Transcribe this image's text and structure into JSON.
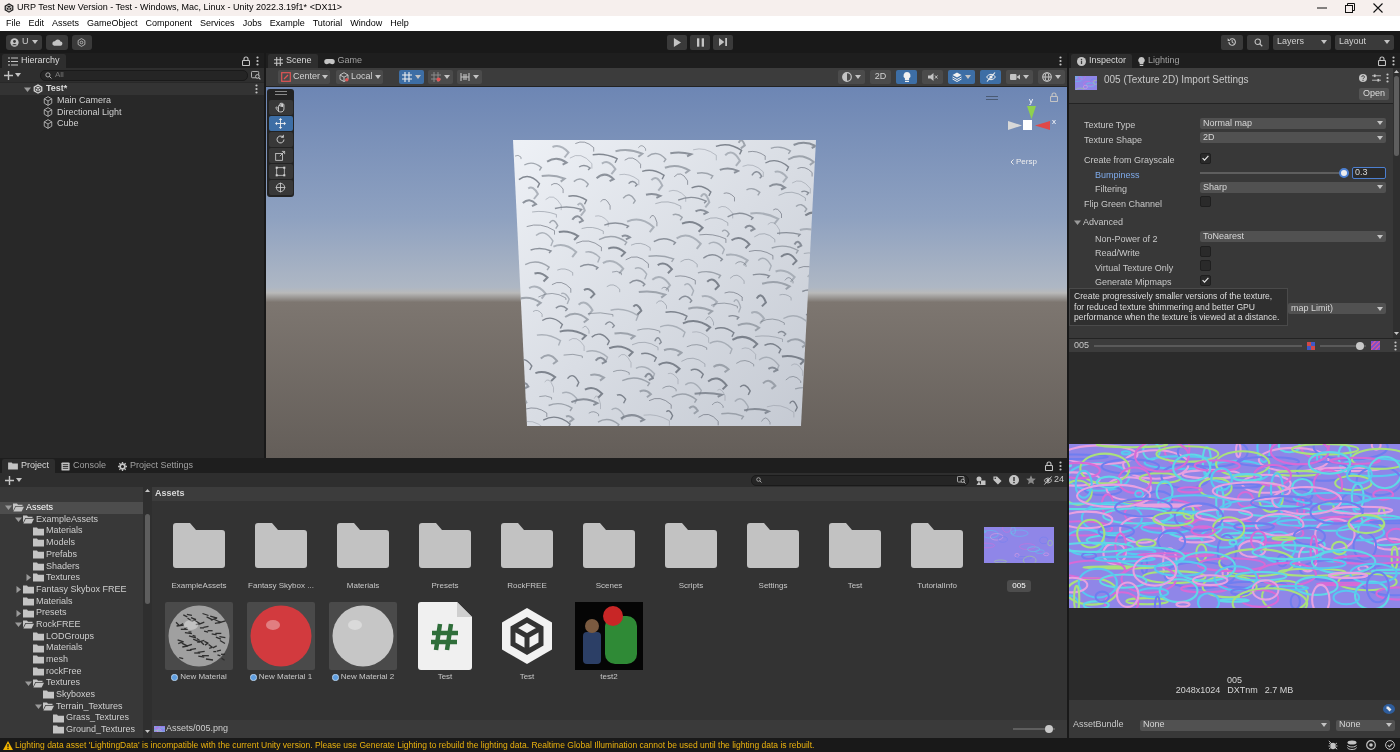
{
  "window": {
    "title": "URP Test New Version - Test - Windows, Mac, Linux - Unity 2022.3.19f1* <DX11>"
  },
  "menu": [
    "File",
    "Edit",
    "Assets",
    "GameObject",
    "Component",
    "Services",
    "Jobs",
    "Example",
    "Tutorial",
    "Window",
    "Help"
  ],
  "toolbar": {
    "account": "U",
    "layers": "Layers",
    "layout": "Layout"
  },
  "hierarchy": {
    "tabs": [
      {
        "label": "Hierarchy",
        "kind": "list",
        "selected": true
      }
    ],
    "search_placeholder": "All",
    "scene": {
      "name": "Test*",
      "expanded": true,
      "children": [
        {
          "name": "Main Camera"
        },
        {
          "name": "Directional Light"
        },
        {
          "name": "Cube"
        }
      ]
    }
  },
  "scene_view": {
    "tabs": [
      {
        "label": "Scene",
        "kind": "scene",
        "selected": true
      },
      {
        "label": "Game",
        "kind": "game",
        "selected": false
      }
    ],
    "pivot": "Center",
    "space": "Local",
    "snapping": [
      {
        "kind": "grid",
        "on": true
      },
      {
        "kind": "dots",
        "on": false
      },
      {
        "kind": "increment",
        "on": false
      }
    ],
    "toggles": [
      {
        "kind": "shading",
        "on": false
      },
      {
        "kind": "mode2d",
        "label": "2D",
        "on": false
      },
      {
        "kind": "lighting",
        "on": true
      },
      {
        "kind": "audio",
        "on": false
      },
      {
        "kind": "effects",
        "on": true
      },
      {
        "kind": "visibility",
        "on": true
      },
      {
        "kind": "camera",
        "on": false
      },
      {
        "kind": "gizmos",
        "on": false
      }
    ],
    "tools": [
      {
        "kind": "hand",
        "selected": false
      },
      {
        "kind": "move",
        "selected": true
      },
      {
        "kind": "rotate",
        "selected": false
      },
      {
        "kind": "scale",
        "selected": false
      },
      {
        "kind": "rect",
        "selected": false
      },
      {
        "kind": "transform",
        "selected": false
      }
    ],
    "gizmo": {
      "y_label": "y",
      "x_label": "x",
      "projection": "Persp"
    }
  },
  "inspector": {
    "tabs": [
      {
        "label": "Inspector",
        "kind": "info",
        "selected": true
      },
      {
        "label": "Lighting",
        "kind": "light",
        "selected": false
      }
    ],
    "title": "005 (Texture 2D) Import Settings",
    "open_button": "Open",
    "properties": [
      {
        "kind": "dropdown",
        "label": "Texture Type",
        "value": "Normal map"
      },
      {
        "kind": "dropdown",
        "label": "Texture Shape",
        "value": "2D"
      },
      {
        "kind": "checkbox",
        "label": "Create from Grayscale",
        "checked": true,
        "children": [
          {
            "kind": "slider",
            "label": "Bumpiness",
            "level": 1,
            "value": "0.3",
            "focused": true
          },
          {
            "kind": "dropdown",
            "label": "Filtering",
            "value": "Sharp"
          }
        ]
      },
      {
        "kind": "checkbox",
        "label": "Flip Green Channel",
        "checked": false
      },
      {
        "kind": "foldout",
        "label": "Advanced",
        "expanded": true,
        "children": [
          {
            "kind": "dropdown",
            "label": "Non-Power of 2",
            "value": "ToNearest"
          },
          {
            "kind": "checkbox",
            "label": "Read/Write",
            "checked": false
          },
          {
            "kind": "checkbox",
            "label": "Virtual Texture Only",
            "checked": false
          },
          {
            "kind": "checkbox",
            "label": "Generate Mipmaps",
            "checked": true
          },
          {
            "kind": "dropdown",
            "value": "map Limit)"
          }
        ]
      }
    ],
    "tooltip": "Create progressively smaller versions of the texture, for reduced texture shimmering and better GPU performance when the texture is viewed at a distance.",
    "preview": {
      "name": "005",
      "slider": {
        "level": 0.95
      },
      "caption": "005",
      "info": [
        "2048x1024",
        "DXTnm",
        "2.7 MB"
      ]
    },
    "asset_bundle": {
      "label": "AssetBundle",
      "name": "None",
      "variant": "None"
    }
  },
  "project": {
    "tabs": [
      {
        "label": "Project",
        "kind": "folder",
        "selected": true
      },
      {
        "label": "Console",
        "kind": "console",
        "selected": false
      },
      {
        "label": "Project Settings",
        "kind": "gear",
        "selected": false
      }
    ],
    "hidden_count": "24",
    "tree": [
      {
        "name": "Assets",
        "expanded": true,
        "selected": true,
        "children": [
          {
            "name": "ExampleAssets",
            "expanded": true,
            "selected": false,
            "children": [
              {
                "name": "Materials",
                "selected": false
              },
              {
                "name": "Models",
                "selected": false
              },
              {
                "name": "Prefabs",
                "selected": false
              },
              {
                "name": "Shaders",
                "selected": false
              },
              {
                "name": "Textures",
                "expanded": false,
                "selected": false
              }
            ]
          },
          {
            "name": "Fantasy Skybox FREE",
            "expanded": false,
            "selected": false
          },
          {
            "name": "Materials",
            "selected": false
          },
          {
            "name": "Presets",
            "expanded": false,
            "selected": false
          },
          {
            "name": "RockFREE",
            "expanded": true,
            "selected": false,
            "children": [
              {
                "name": "LODGroups",
                "selected": false
              },
              {
                "name": "Materials",
                "selected": false
              },
              {
                "name": "mesh",
                "selected": false
              },
              {
                "name": "rockFree",
                "selected": false
              },
              {
                "name": "Textures",
                "expanded": true,
                "selected": false,
                "children": [
                  {
                    "name": "Skyboxes",
                    "selected": false
                  },
                  {
                    "name": "Terrain_Textures",
                    "expanded": true,
                    "selected": false,
                    "children": [
                      {
                        "name": "Grass_Textures",
                        "selected": false
                      },
                      {
                        "name": "Ground_Textures",
                        "selected": false
                      }
                    ]
                  }
                ]
              }
            ]
          }
        ]
      }
    ],
    "breadcrumb": "Assets",
    "items": [
      {
        "label": "ExampleAssets",
        "kind": "folder",
        "selected": false
      },
      {
        "label": "Fantasy Skybox ...",
        "kind": "folder",
        "selected": false
      },
      {
        "label": "Materials",
        "kind": "folder",
        "selected": false
      },
      {
        "label": "Presets",
        "kind": "folder",
        "selected": false
      },
      {
        "label": "RockFREE",
        "kind": "folder",
        "selected": false
      },
      {
        "label": "Scenes",
        "kind": "folder",
        "selected": false
      },
      {
        "label": "Scripts",
        "kind": "folder",
        "selected": false
      },
      {
        "label": "Settings",
        "kind": "folder",
        "selected": false
      },
      {
        "label": "Test",
        "kind": "folder",
        "selected": false
      },
      {
        "label": "TutorialInfo",
        "kind": "folder",
        "selected": false
      },
      {
        "label": "005",
        "kind": "texture",
        "selected": true
      },
      {
        "label": "New Material",
        "kind": "material",
        "color": "#a0a0a0",
        "textured": true,
        "selected": false
      },
      {
        "label": "New Material 1",
        "kind": "material",
        "color": "#d23a3e",
        "textured": false,
        "selected": false
      },
      {
        "label": "New Material 2",
        "kind": "material",
        "color": "#c6c6c6",
        "textured": false,
        "selected": false
      },
      {
        "label": "Test",
        "kind": "script",
        "selected": false
      },
      {
        "label": "Test",
        "kind": "scene",
        "selected": false
      },
      {
        "label": "test2",
        "kind": "image",
        "selected": false
      }
    ],
    "path": "Assets/005.png",
    "zoom": {
      "level": 0.93
    }
  },
  "status": {
    "message": "Lighting data asset 'LightingData' is incompatible with the current Unity version. Please use Generate Lighting to rebuild the lighting data. Realtime Global Illumination cannot be used until the lighting data is rebuilt."
  }
}
